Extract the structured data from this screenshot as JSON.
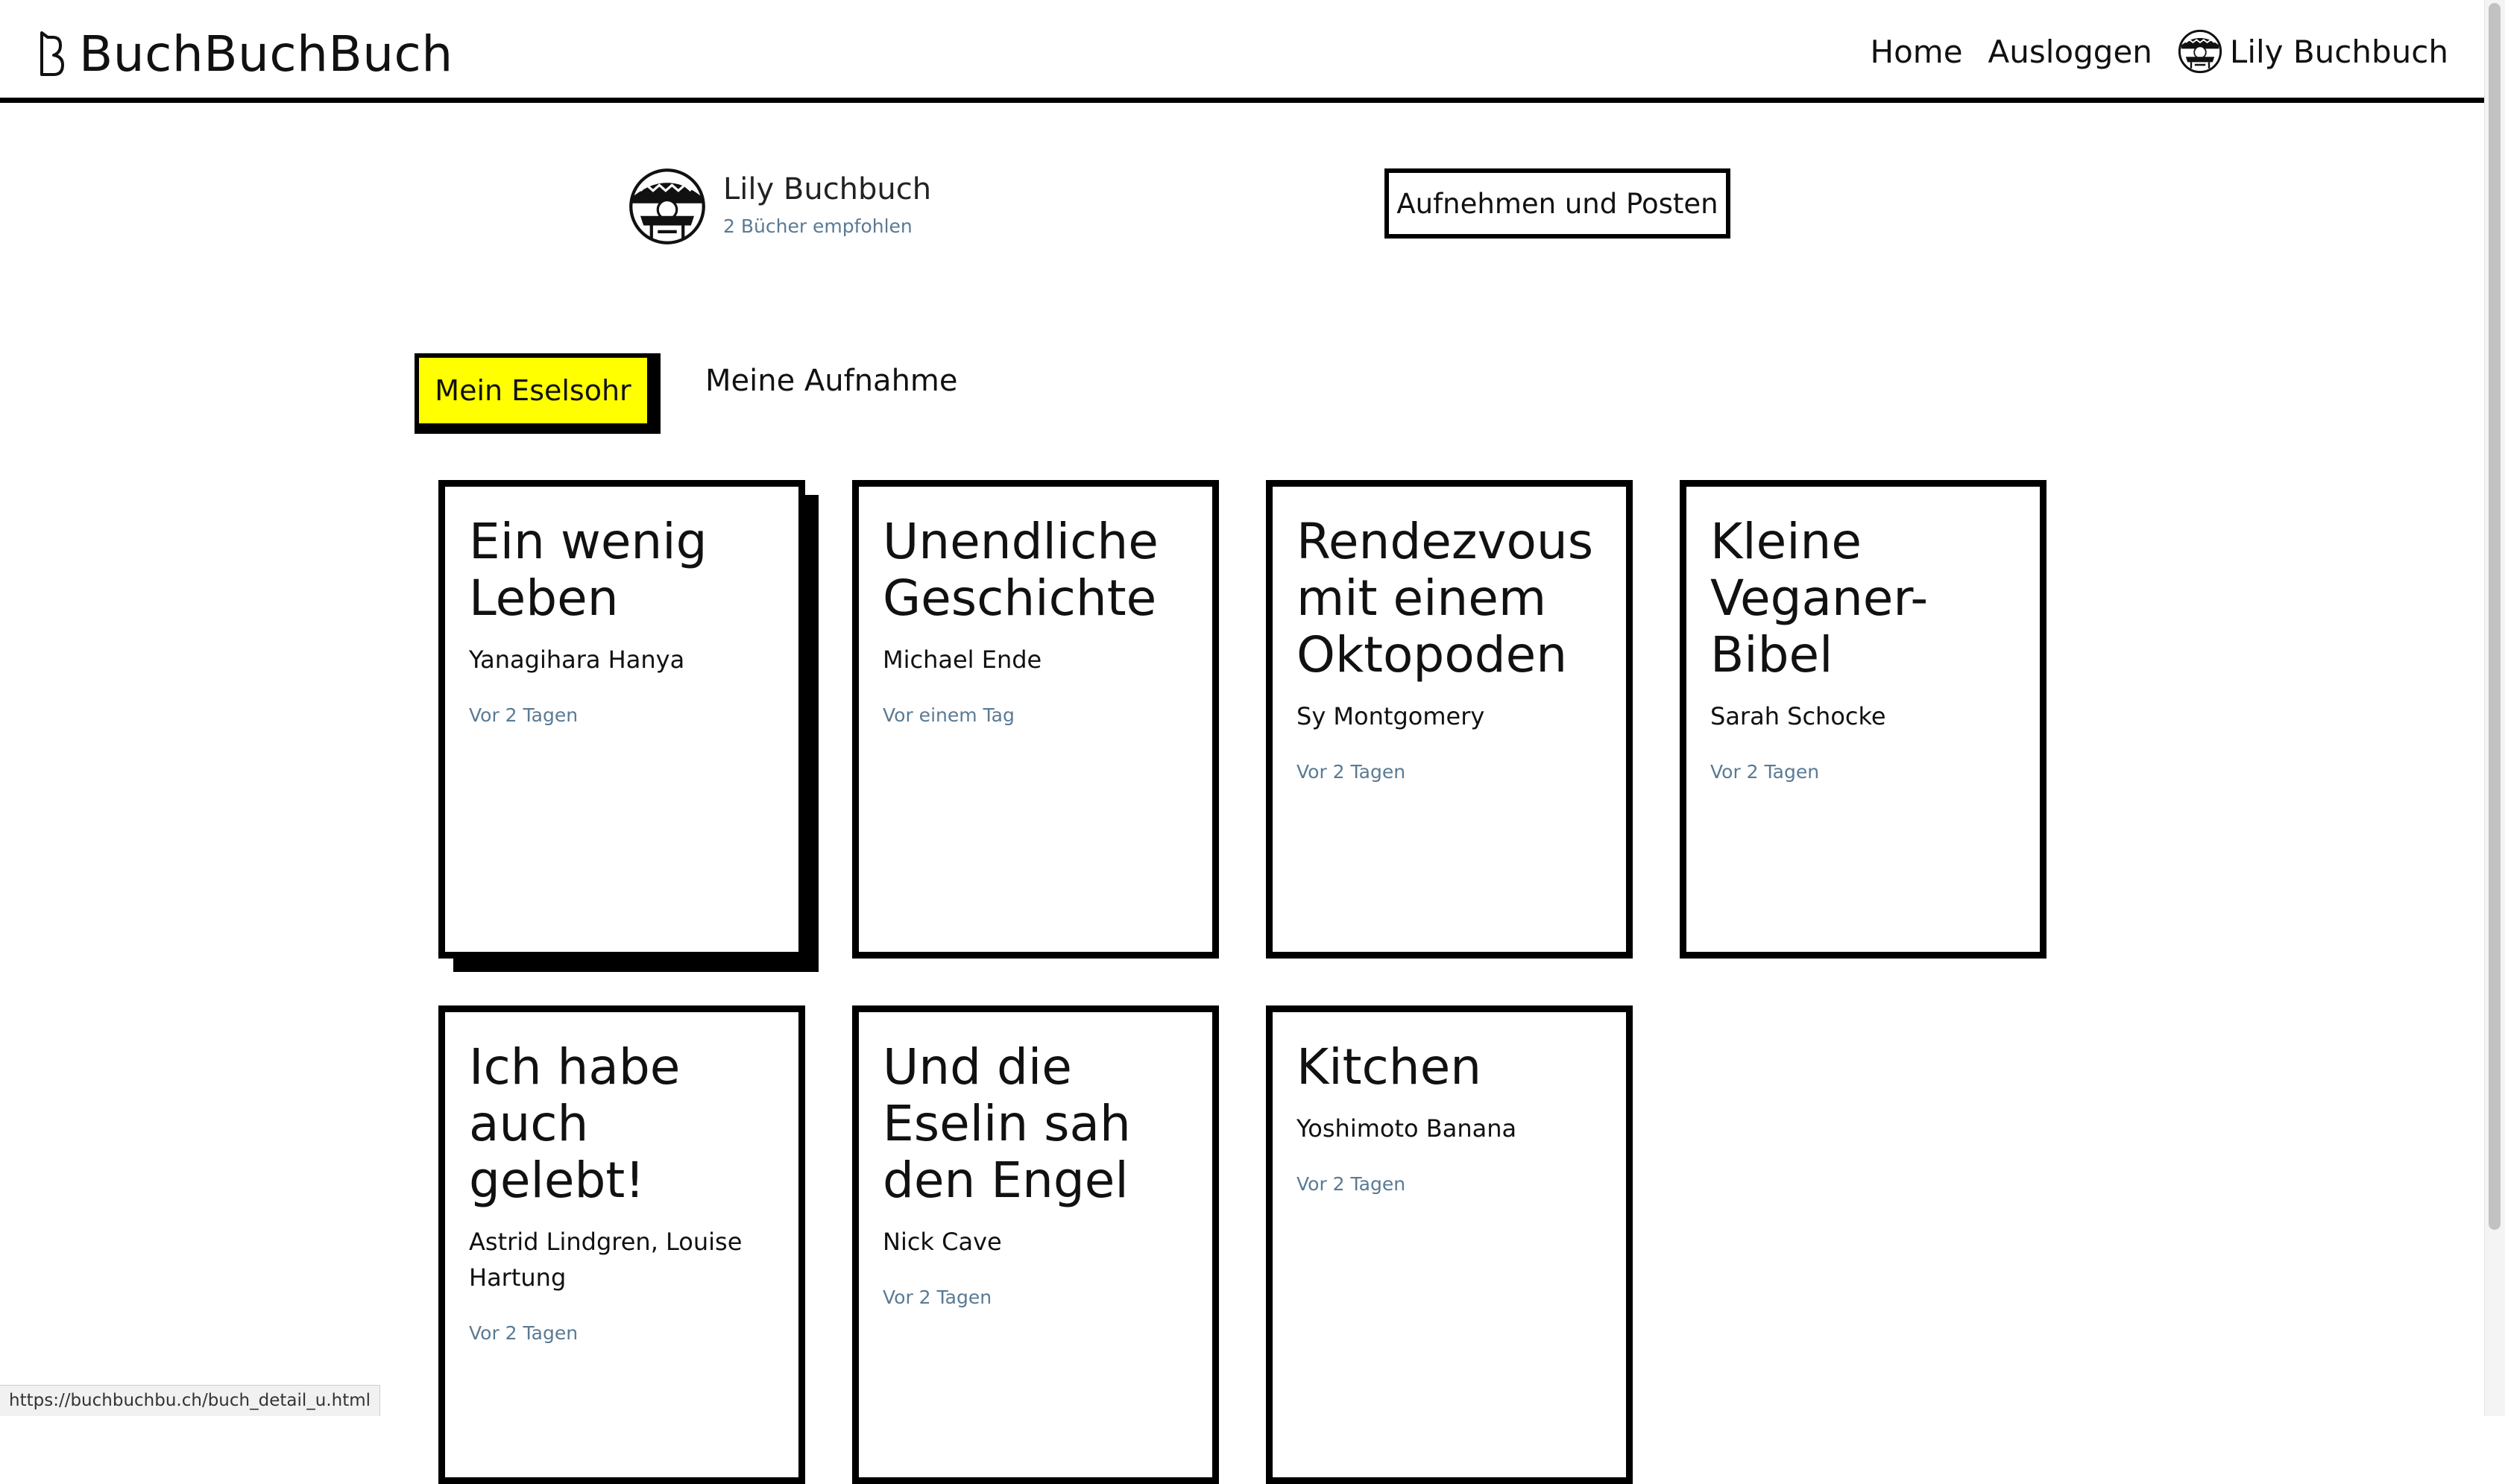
{
  "header": {
    "logo_text": "BuchBuchBuch",
    "nav": {
      "home": "Home",
      "logout": "Ausloggen",
      "user_name": "Lily Buchbuch"
    }
  },
  "profile": {
    "name": "Lily Buchbuch",
    "books_count": "2 Bücher empfohlen",
    "post_button": "Aufnehmen und Posten"
  },
  "tabs": [
    {
      "label": "Mein Eselsohr",
      "active": true
    },
    {
      "label": "Meine Aufnahme",
      "active": false
    }
  ],
  "books": [
    {
      "title": "Ein wenig Leben",
      "author": "Yanagihara Hanya",
      "date": "Vor 2 Tagen"
    },
    {
      "title": "Unendliche Geschichte",
      "author": "Michael Ende",
      "date": "Vor einem Tag"
    },
    {
      "title": "Rendezvous mit einem Oktopoden",
      "author": "Sy Montgomery",
      "date": "Vor 2 Tagen"
    },
    {
      "title": "Kleine Veganer-Bibel",
      "author": "Sarah Schocke",
      "date": "Vor 2 Tagen"
    },
    {
      "title": "Ich habe auch gelebt!",
      "author": "Astrid Lindgren, Louise Hartung",
      "date": "Vor 2 Tagen"
    },
    {
      "title": "Und die Eselin sah den Engel",
      "author": "Nick Cave",
      "date": "Vor 2 Tagen"
    },
    {
      "title": "Kitchen",
      "author": "Yoshimoto Banana",
      "date": "Vor 2 Tagen"
    }
  ],
  "status_bar": {
    "url": "https://buchbuchbu.ch/buch_detail_u.html"
  },
  "colors": {
    "active_tab": "#ffff00",
    "muted_text": "#5a7a94",
    "border": "#000000"
  }
}
